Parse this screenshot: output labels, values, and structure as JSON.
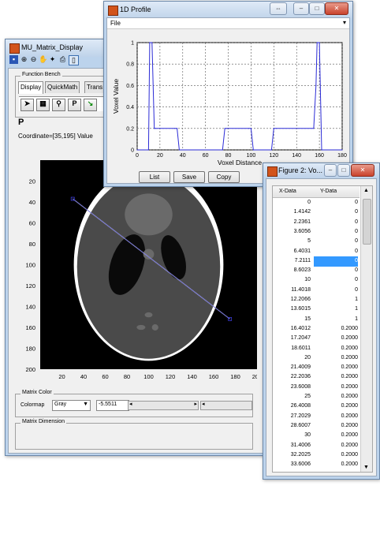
{
  "matrix_window": {
    "title": "MU_Matrix_Display",
    "function_bench_label": "Function Bench",
    "tabs": [
      "Display",
      "QuickMath",
      "Trans"
    ],
    "p_label": "P",
    "coordinate_text": "Coordinate=[35,195] Value",
    "matrix_color_label": "Matrix Color",
    "colormap_label": "Colormap",
    "colormap_value": "Gray",
    "range_value": "-5.5511",
    "matrix_dimension_label": "Matrix Dimension",
    "y_ticks": [
      "20",
      "40",
      "60",
      "80",
      "100",
      "120",
      "140",
      "160",
      "180",
      "200"
    ],
    "x_ticks": [
      "20",
      "40",
      "60",
      "80",
      "100",
      "120",
      "140",
      "160",
      "180",
      "200"
    ],
    "line_start": [
      30,
      37
    ],
    "line_end": [
      175,
      152
    ]
  },
  "profile_window": {
    "title": "1D Profile",
    "menu_file": "File",
    "menu_arrow": "▾",
    "xlabel": "Voxel Distance",
    "ylabel": "Voxel Value",
    "buttons": [
      "List",
      "Save",
      "Copy"
    ],
    "minimize_label": "–",
    "maximize_label": "□",
    "close_label": "✕"
  },
  "chart_data": {
    "type": "line",
    "xlabel": "Voxel Distance",
    "ylabel": "Voxel Value",
    "xlim": [
      0,
      180
    ],
    "ylim": [
      0,
      1
    ],
    "x_ticks": [
      0,
      20,
      40,
      60,
      80,
      100,
      120,
      140,
      160,
      180
    ],
    "y_ticks": [
      0,
      0.2,
      0.4,
      0.6,
      0.8,
      1
    ],
    "grid": true,
    "x": [
      0,
      10,
      11,
      13,
      15,
      16,
      33,
      35,
      37,
      75,
      77,
      79,
      98,
      100,
      102,
      118,
      120,
      122,
      155,
      157,
      158,
      160,
      162,
      180
    ],
    "y": [
      0,
      0,
      1,
      1,
      0.2,
      0.2,
      0.2,
      0.2,
      0,
      0,
      0.2,
      0.2,
      0.2,
      0.2,
      0,
      0,
      0.2,
      0.2,
      0.2,
      0.6,
      1,
      1,
      0,
      0
    ]
  },
  "figure_window": {
    "title": "Figure 2: Vo...",
    "col_x": "X-Data",
    "col_y": "Y-Data",
    "rows": [
      [
        "0",
        "0"
      ],
      [
        "1.4142",
        "0"
      ],
      [
        "2.2361",
        "0"
      ],
      [
        "3.6056",
        "0"
      ],
      [
        "5",
        "0"
      ],
      [
        "6.4031",
        "0"
      ],
      [
        "7.2111",
        "0"
      ],
      [
        "8.6023",
        "0"
      ],
      [
        "10",
        "0"
      ],
      [
        "11.4018",
        "0"
      ],
      [
        "12.2066",
        "1"
      ],
      [
        "13.6015",
        "1"
      ],
      [
        "15",
        "1"
      ],
      [
        "16.4012",
        "0.2000"
      ],
      [
        "17.2047",
        "0.2000"
      ],
      [
        "18.6011",
        "0.2000"
      ],
      [
        "20",
        "0.2000"
      ],
      [
        "21.4009",
        "0.2000"
      ],
      [
        "22.2036",
        "0.2000"
      ],
      [
        "23.6008",
        "0.2000"
      ],
      [
        "25",
        "0.2000"
      ],
      [
        "26.4008",
        "0.2000"
      ],
      [
        "27.2029",
        "0.2000"
      ],
      [
        "28.6007",
        "0.2000"
      ],
      [
        "30",
        "0.2000"
      ],
      [
        "31.4006",
        "0.2000"
      ],
      [
        "32.2025",
        "0.2000"
      ],
      [
        "33.6006",
        "0.2000"
      ]
    ],
    "selected_row": 6
  }
}
